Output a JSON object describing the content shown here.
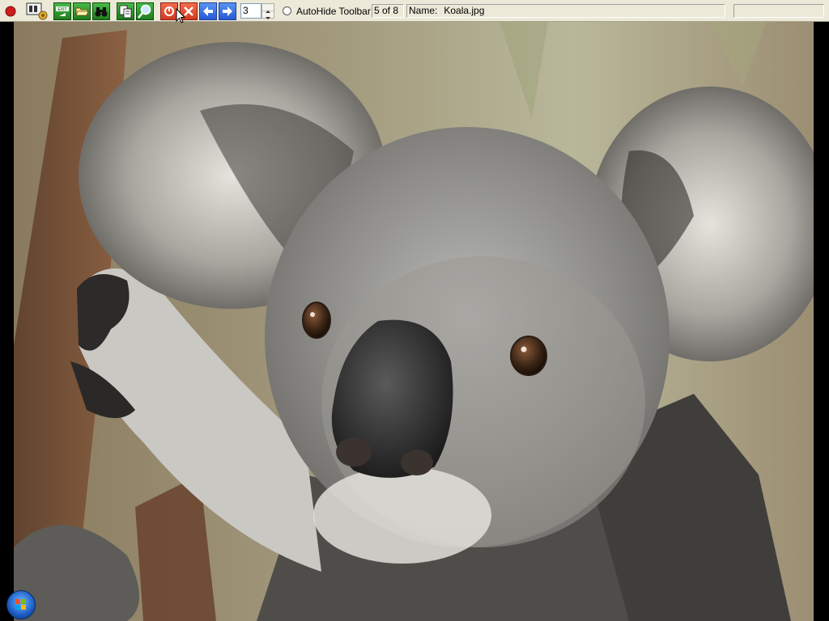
{
  "toolbar": {
    "spinner_value": "3",
    "autohide_label": "AutoHide Toolbar",
    "position_text": "5 of 8",
    "name_label": "Name:",
    "file_name": "Koala.jpg",
    "icons": {
      "record": "record-icon",
      "settings": "settings-icon",
      "exit": "exit-icon",
      "open": "open-folder-icon",
      "find": "binoculars-icon",
      "copy": "copy-icon",
      "zoom": "zoom-icon",
      "clear": "clear-icon",
      "delete": "delete-icon",
      "prev": "arrow-left-icon",
      "next": "arrow-right-icon"
    },
    "colors": {
      "toolbar_bg": "#ece9d8",
      "record_red": "#cc1f1f",
      "green_button": "#2f8f2f",
      "blue_button": "#2659d6",
      "red_button": "#d23a1e"
    }
  },
  "taskbar": {
    "start_icon": "windows-start-orb-icon"
  },
  "image": {
    "subject": "koala-photo"
  }
}
